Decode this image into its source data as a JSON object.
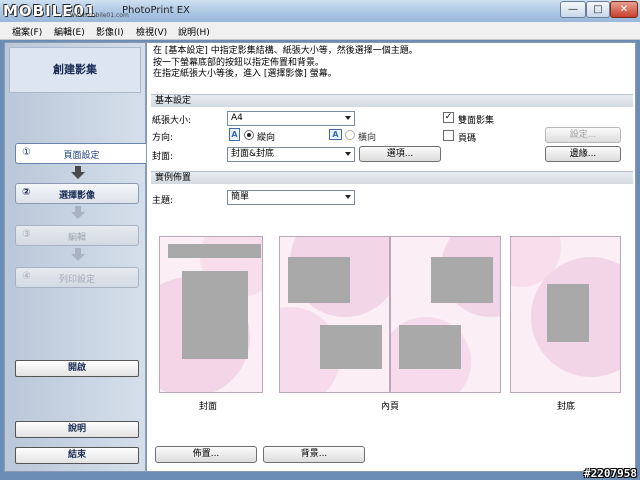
{
  "window": {
    "watermark_logo": "MOBILE01",
    "watermark_sub": "www.mobile01.com",
    "title": "PhotoPrint EX",
    "min_glyph": "—",
    "max_glyph": "□",
    "close_glyph": "✕"
  },
  "menu": [
    "檔案(F)",
    "編輯(E)",
    "影像(I)",
    "檢視(V)",
    "說明(H)"
  ],
  "sidebar": {
    "title": "創建影集",
    "steps": [
      {
        "num": "①",
        "label": "頁面設定"
      },
      {
        "num": "②",
        "label": "選擇影像"
      },
      {
        "num": "③",
        "label": "編輯"
      },
      {
        "num": "④",
        "label": "列印設定"
      }
    ],
    "open_button": "開啟",
    "help_button": "說明",
    "exit_button": "結束"
  },
  "intro": [
    "在 [基本設定] 中指定影集結構、紙張大小等，然後選擇一個主題。",
    "按一下螢幕底部的按鈕以指定佈置和背景。",
    "在指定紙張大小等後，進入 [選擇影像] 螢幕。"
  ],
  "basic": {
    "header": "基本設定",
    "paper_size_label": "紙張大小:",
    "paper_size_value": "A4",
    "orientation_label": "方向:",
    "portrait_icon": "A",
    "portrait_label": "縱向",
    "landscape_icon": "A",
    "landscape_label": "橫向",
    "cover_label": "封面:",
    "cover_value": "封面&封底",
    "options_button": "選項...",
    "double_sided_label": "雙面影集",
    "double_sided_checked": true,
    "page_numbers_label": "頁碼",
    "page_numbers_checked": false,
    "settings_button": "設定...",
    "border_button": "邊緣..."
  },
  "layout_sample": {
    "header": "實例佈置",
    "theme_label": "主題:",
    "theme_value": "簡單",
    "front_cover_caption": "封面",
    "inner_pages_caption": "內頁",
    "back_cover_caption": "封底"
  },
  "bottom": {
    "layout_button": "佈置...",
    "background_button": "背景..."
  },
  "post_id": "#2207958",
  "colors": {
    "page_bg": "#fbeef4",
    "photo_placeholder": "#a9a9a9",
    "accent": "#1a2c55"
  }
}
